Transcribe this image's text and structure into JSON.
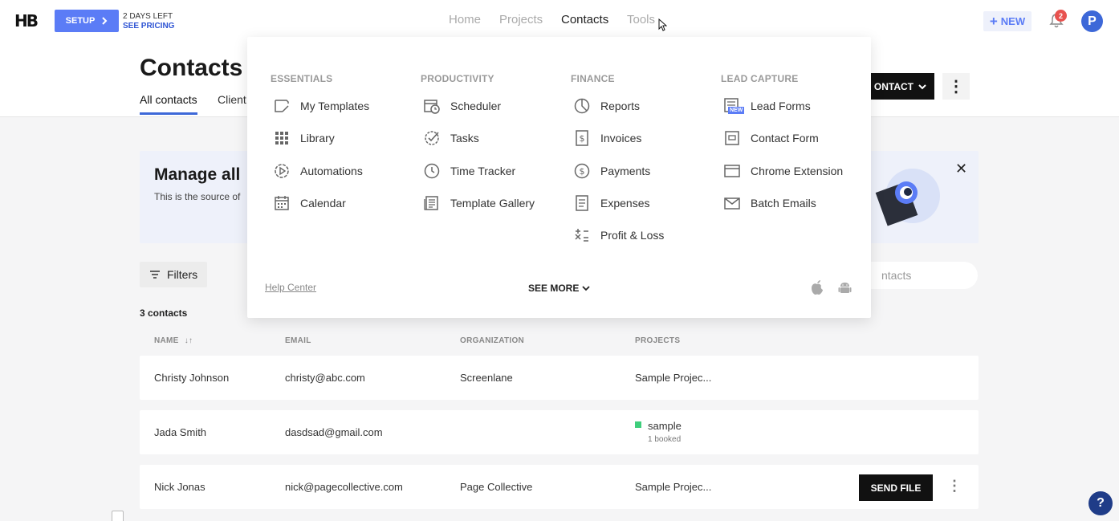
{
  "brand": {
    "logo": "HB"
  },
  "setup": {
    "label": "SETUP",
    "days_left": "2 DAYS LEFT",
    "see_pricing": "SEE PRICING"
  },
  "nav": {
    "home": "Home",
    "projects": "Projects",
    "contacts": "Contacts",
    "tools": "Tools"
  },
  "header_actions": {
    "new_label": "NEW",
    "notification_count": "2",
    "avatar_initial": "P"
  },
  "page": {
    "title": "Contacts",
    "tabs": [
      {
        "label": "All contacts",
        "active": true
      },
      {
        "label": "Client"
      }
    ],
    "add_contact_label": "ONTACT"
  },
  "banner": {
    "title": "Manage all",
    "subtitle": "This is the source of"
  },
  "filters": {
    "label": "Filters"
  },
  "search": {
    "placeholder": "ntacts"
  },
  "list": {
    "count": "3 contacts",
    "columns": [
      "NAME",
      "EMAIL",
      "ORGANIZATION",
      "PROJECTS"
    ],
    "rows": [
      {
        "name": "Christy Johnson",
        "email": "christy@abc.com",
        "organization": "Screenlane",
        "project": "Sample Projec..."
      },
      {
        "name": "Jada Smith",
        "email": "dasdsad@gmail.com",
        "organization": "",
        "project": "sample",
        "project_sub": "1 booked"
      },
      {
        "name": "Nick Jonas",
        "email": "nick@pagecollective.com",
        "organization": "Page Collective",
        "project": "Sample Projec...",
        "action": "SEND FILE"
      }
    ]
  },
  "tools_menu": {
    "columns": [
      {
        "heading": "ESSENTIALS",
        "items": [
          "My Templates",
          "Library",
          "Automations",
          "Calendar"
        ]
      },
      {
        "heading": "PRODUCTIVITY",
        "items": [
          "Scheduler",
          "Tasks",
          "Time Tracker",
          "Template Gallery"
        ]
      },
      {
        "heading": "FINANCE",
        "items": [
          "Reports",
          "Invoices",
          "Payments",
          "Expenses",
          "Profit & Loss"
        ]
      },
      {
        "heading": "LEAD CAPTURE",
        "items": [
          "Lead Forms",
          "Contact Form",
          "Chrome Extension",
          "Batch Emails"
        ]
      }
    ],
    "new_badge": "NEW",
    "help_center": "Help Center",
    "see_more": "SEE MORE"
  },
  "help_fab": "?",
  "colors": {
    "accent": "#5b7cf6",
    "brand_blue": "#3d68d8",
    "badge_red": "#e8524f",
    "booked_green": "#3fce7c"
  }
}
